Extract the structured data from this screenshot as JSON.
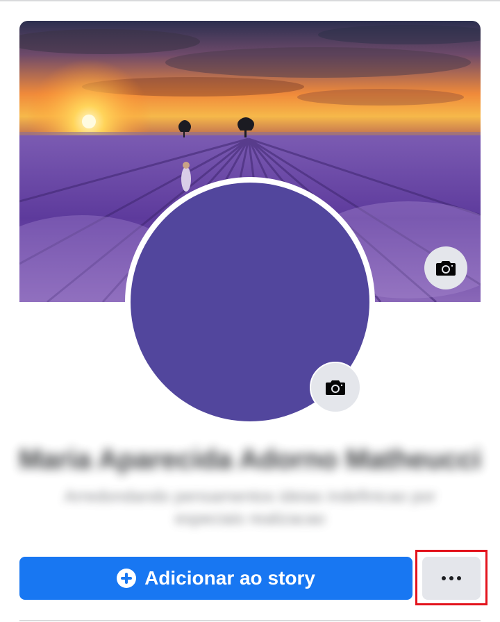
{
  "profile": {
    "name": "Maria Aparecida Adorno Matheucci",
    "bio": "Arredondando pensamentos ideias indefinicao por especiais realizacao"
  },
  "actions": {
    "add_story_label": "Adicionar ao story"
  },
  "icons": {
    "cover_camera": "camera-icon",
    "avatar_camera": "camera-icon",
    "add_story": "plus-circle-icon",
    "more": "more-horizontal-icon"
  },
  "colors": {
    "primary": "#1877f2",
    "avatar_fill": "#52469d",
    "button_secondary": "#e4e6eb",
    "highlight": "#e3131c"
  }
}
